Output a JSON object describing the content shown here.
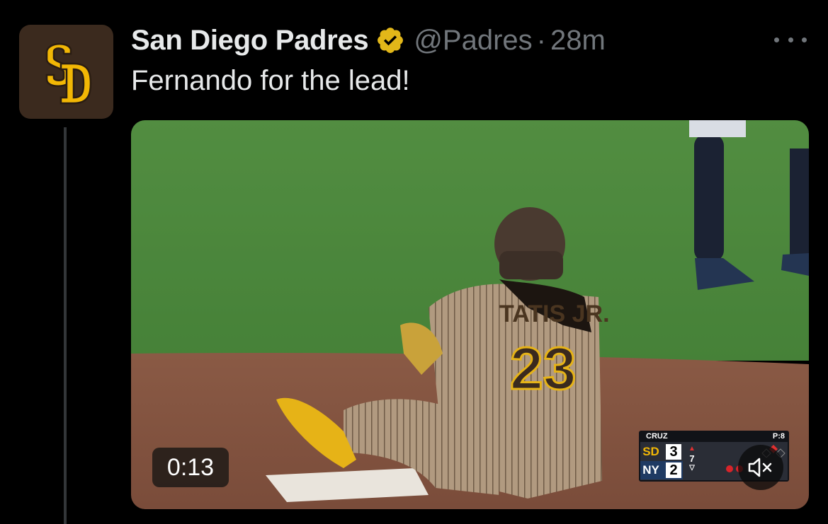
{
  "tweet": {
    "author": {
      "display_name": "San Diego Padres",
      "handle": "@Padres",
      "avatar_text": "SD",
      "verified": true
    },
    "separator": "·",
    "time": "28m",
    "text": "Fernando for the lead!",
    "media": {
      "type": "video",
      "duration": "0:13",
      "muted": true,
      "jersey_name": "TATIS JR.",
      "jersey_number": "23",
      "scorebug": {
        "batter": "CRUZ",
        "pitch_count": "P:8",
        "away_team_logo": "SD",
        "away_score": "3",
        "home_team_logo": "NY",
        "home_score": "2",
        "inning": "7",
        "inning_half": "top",
        "outs": 2
      }
    }
  },
  "colors": {
    "background": "#000000",
    "text_primary": "#e7e9ea",
    "text_secondary": "#71767b",
    "verified_badge": "#e2b719",
    "padres_gold": "#f2b705",
    "padres_brown": "#3b2a1e"
  }
}
